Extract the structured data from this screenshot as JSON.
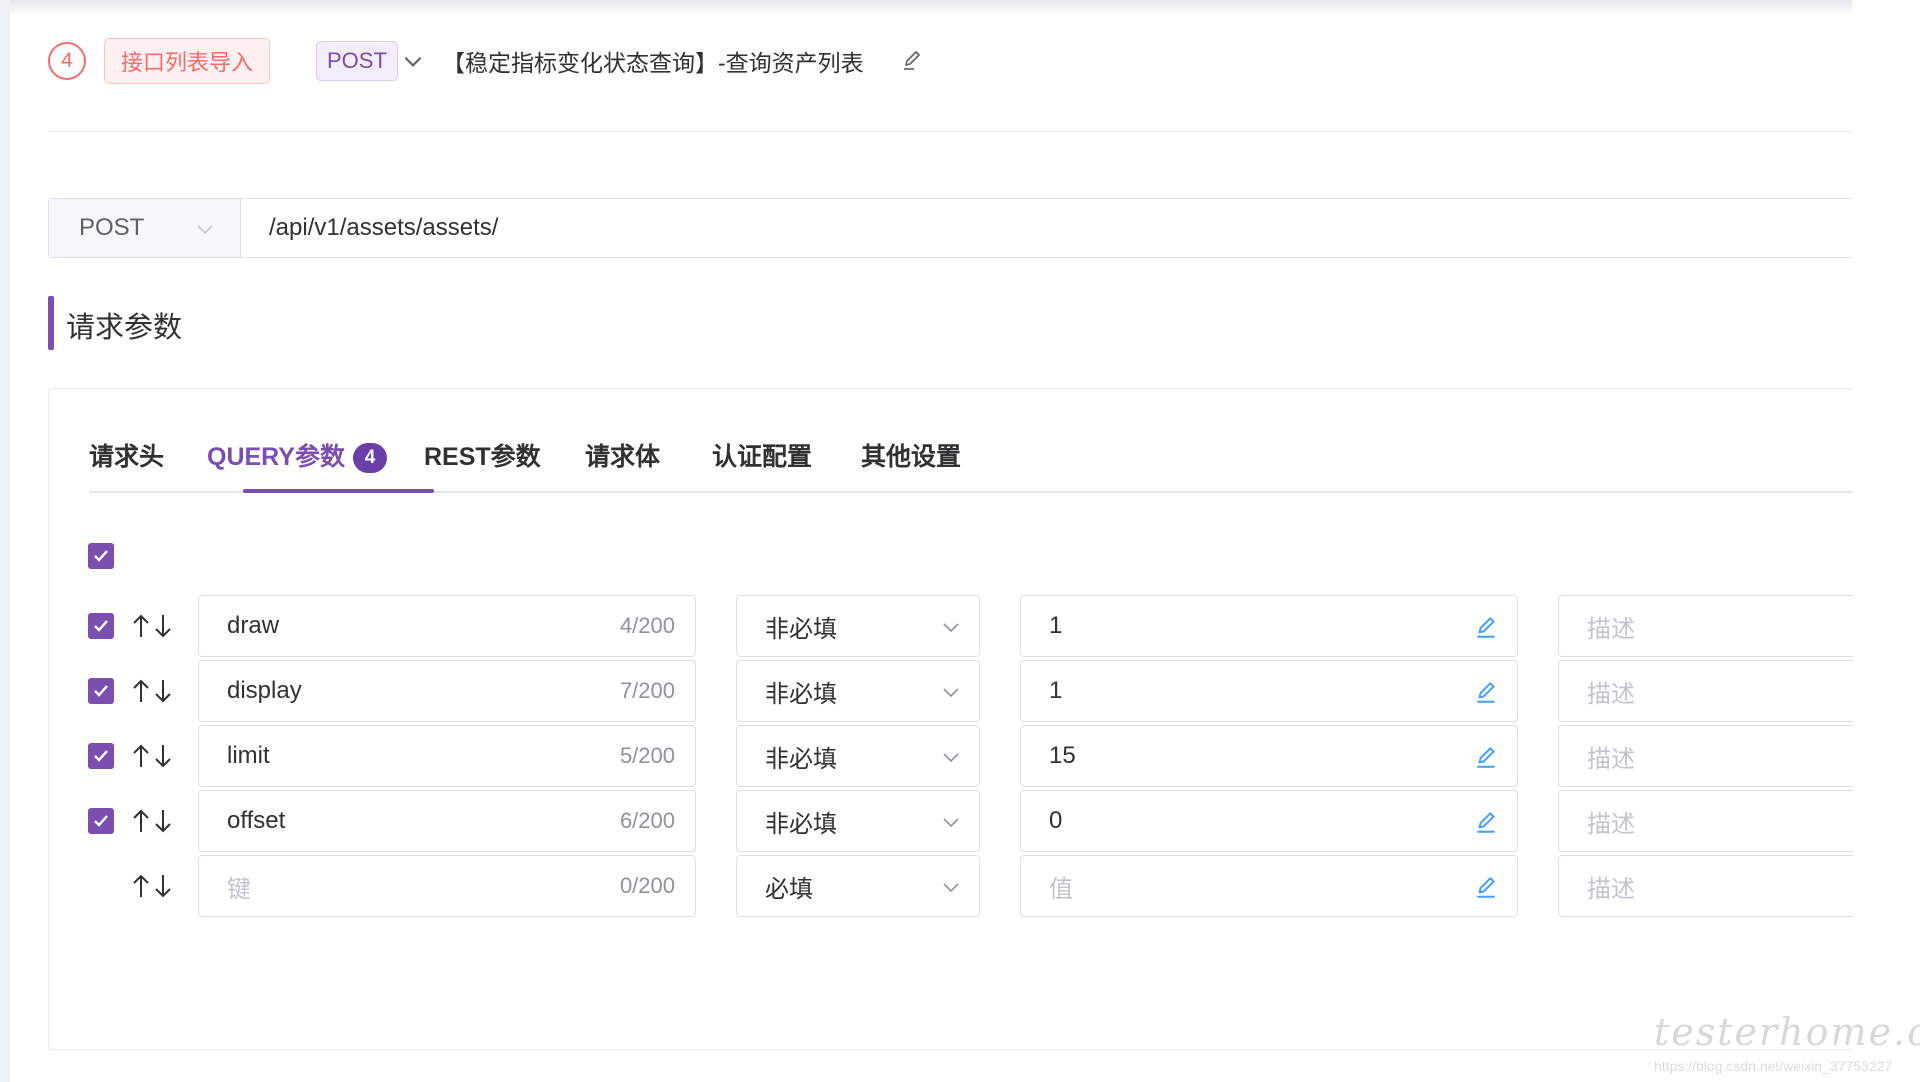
{
  "header": {
    "step_number": "4",
    "import_tag": "接口列表导入",
    "method": "POST",
    "api_title": "【稳定指标变化状态查询】-查询资产列表"
  },
  "url_bar": {
    "method": "POST",
    "url": "/api/v1/assets/assets/"
  },
  "section": {
    "title": "请求参数"
  },
  "tabs": [
    {
      "label": "请求头"
    },
    {
      "label": "QUERY参数",
      "badge": "4",
      "active": true
    },
    {
      "label": "REST参数"
    },
    {
      "label": "请求体"
    },
    {
      "label": "认证配置"
    },
    {
      "label": "其他设置"
    }
  ],
  "params": [
    {
      "checked": true,
      "key": "draw",
      "count": "4/200",
      "required": "非必填",
      "value": "1",
      "desc_placeholder": "描述"
    },
    {
      "checked": true,
      "key": "display",
      "count": "7/200",
      "required": "非必填",
      "value": "1",
      "desc_placeholder": "描述"
    },
    {
      "checked": true,
      "key": "limit",
      "count": "5/200",
      "required": "非必填",
      "value": "15",
      "desc_placeholder": "描述"
    },
    {
      "checked": true,
      "key": "offset",
      "count": "6/200",
      "required": "非必填",
      "value": "0",
      "desc_placeholder": "描述"
    }
  ],
  "new_row": {
    "key_placeholder": "键",
    "count": "0/200",
    "required": "必填",
    "value_placeholder": "值",
    "desc_placeholder": "描述"
  },
  "watermark": {
    "logo": "testerhome.com",
    "url": "https://blog.csdn.net/weixin_37753227"
  },
  "colors": {
    "accent": "#7b4fb0",
    "danger": "#f56c6c",
    "edit_icon": "#409eff"
  },
  "icons": {
    "sort": "up-down-arrows-icon",
    "edit": "pencil-edit-icon",
    "dropdown": "chevron-down-icon",
    "check": "checkmark-icon"
  }
}
